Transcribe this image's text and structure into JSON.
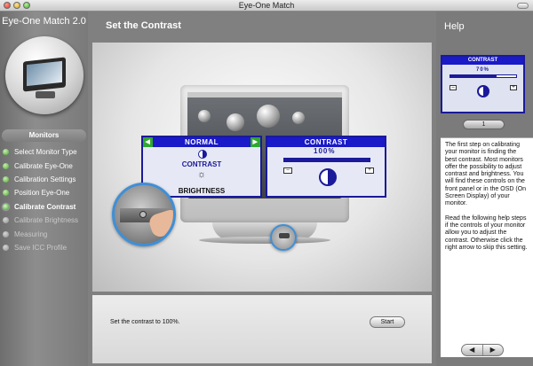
{
  "window": {
    "title": "Eye-One Match"
  },
  "sidebar": {
    "logo": "Eye-One Match 2.0",
    "section_label": "Monitors",
    "steps": [
      {
        "label": "Select Monitor Type",
        "state": "done"
      },
      {
        "label": "Calibrate Eye-One",
        "state": "done"
      },
      {
        "label": "Calibration Settings",
        "state": "done"
      },
      {
        "label": "Position Eye-One",
        "state": "done"
      },
      {
        "label": "Calibrate Contrast",
        "state": "active"
      },
      {
        "label": "Calibrate Brightness",
        "state": "pending"
      },
      {
        "label": "Measuring",
        "state": "pending"
      },
      {
        "label": "Save ICC Profile",
        "state": "pending"
      }
    ]
  },
  "main": {
    "title": "Set the Contrast",
    "osd_normal": {
      "header": "NORMAL",
      "contrast": "CONTRAST",
      "brightness": "BRIGHTNESS"
    },
    "osd_contrast": {
      "header": "CONTRAST",
      "value": "100%",
      "level": 1.0
    },
    "instruction": "Set the contrast to 100%.",
    "start_button": "Start"
  },
  "help": {
    "title": "Help",
    "preview": {
      "header": "CONTRAST",
      "value": "70%",
      "level": 0.7
    },
    "page_indicator": "1",
    "paragraph1": "The first step on calibrating your monitor is finding the best contrast. Most monitors offer the possibility to adjust contrast and brightness. You will find these controls on the front panel or in the OSD (On Screen Display) of your monitor.",
    "paragraph2": "Read the following help steps if the controls of your monitor allow you to adjust the contrast. Otherwise click the right arrow to skip this setting.",
    "prev_label": "◀",
    "next_label": "▶"
  },
  "colors": {
    "osd_blue": "#1a1ac8",
    "step_done": "#4aa030",
    "ring_blue": "#3f8fd6"
  }
}
